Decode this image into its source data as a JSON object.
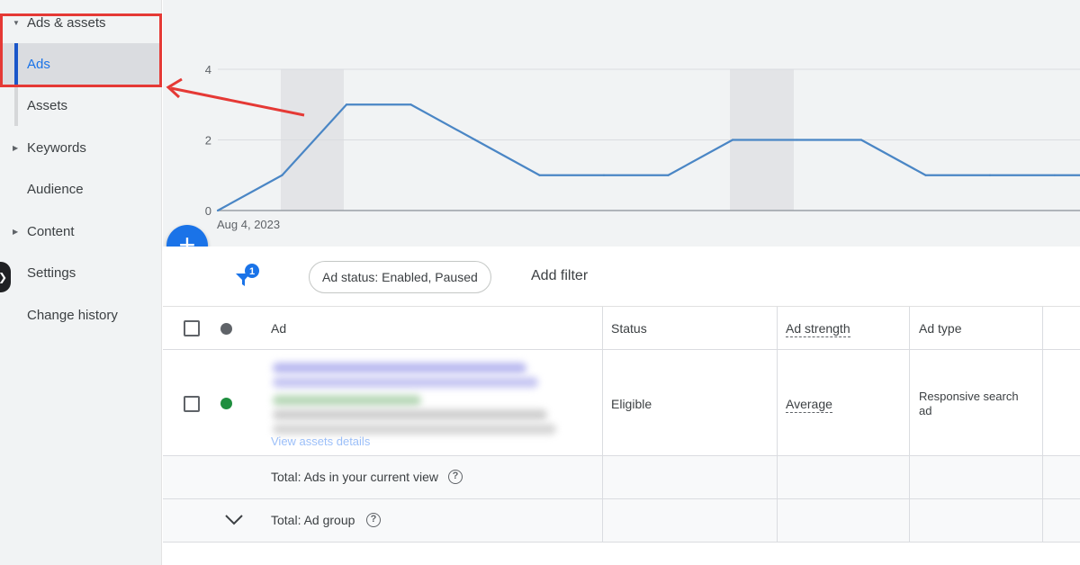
{
  "sidebar": {
    "items": [
      {
        "label": "Ads & assets",
        "caret": "▼"
      },
      {
        "label": "Ads"
      },
      {
        "label": "Assets"
      },
      {
        "label": "Keywords",
        "caret": "▶"
      },
      {
        "label": "Audience"
      },
      {
        "label": "Content",
        "caret": "▶"
      },
      {
        "label": "Settings"
      },
      {
        "label": "Change history"
      }
    ],
    "collapse_icon": "chevron-right-icon"
  },
  "chart_data": {
    "type": "line",
    "x": [
      "Aug 4, 2023"
    ],
    "yticks": [
      0,
      2,
      4
    ],
    "ylim": [
      0,
      4
    ],
    "series": [
      {
        "values": [
          0,
          1,
          3,
          3,
          2,
          1,
          1,
          1,
          2,
          2,
          2,
          1,
          1,
          1
        ]
      }
    ],
    "color": "#4a86c5",
    "grid": true
  },
  "fab": {
    "icon": "plus-icon",
    "label": "+"
  },
  "filter_bar": {
    "filter_count": "1",
    "chip_label": "Ad status: Enabled, Paused",
    "add_filter_label": "Add filter"
  },
  "table": {
    "headers": {
      "ad": "Ad",
      "status": "Status",
      "ad_strength": "Ad strength",
      "ad_type": "Ad type"
    },
    "rows": [
      {
        "link": "View assets details",
        "status": "Eligible",
        "ad_strength": "Average",
        "ad_type": "Responsive search ad",
        "status_color": "#1e8e3e"
      }
    ],
    "totals": {
      "current_view": "Total: Ads in your current view",
      "ad_group": "Total: Ad group",
      "help_glyph": "?"
    }
  },
  "annotation": {
    "box_color": "#e53935",
    "arrow_color": "#e53935"
  }
}
